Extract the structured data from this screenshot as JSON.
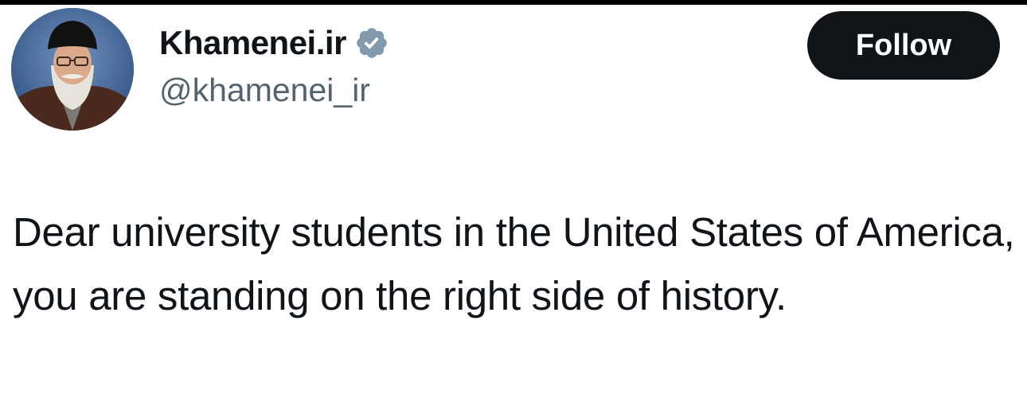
{
  "author": {
    "display_name": "Khamenei.ir",
    "handle": "@khamenei_ir",
    "verified_icon": "verified-badge-icon",
    "verified_color": "#829aab"
  },
  "actions": {
    "follow_label": "Follow"
  },
  "tweet": {
    "text": "Dear university students in the United States of America, you are standing on the right side of history."
  },
  "colors": {
    "text": "#0f1419",
    "secondary": "#536471",
    "button_bg": "#0f1419",
    "button_text": "#ffffff"
  }
}
